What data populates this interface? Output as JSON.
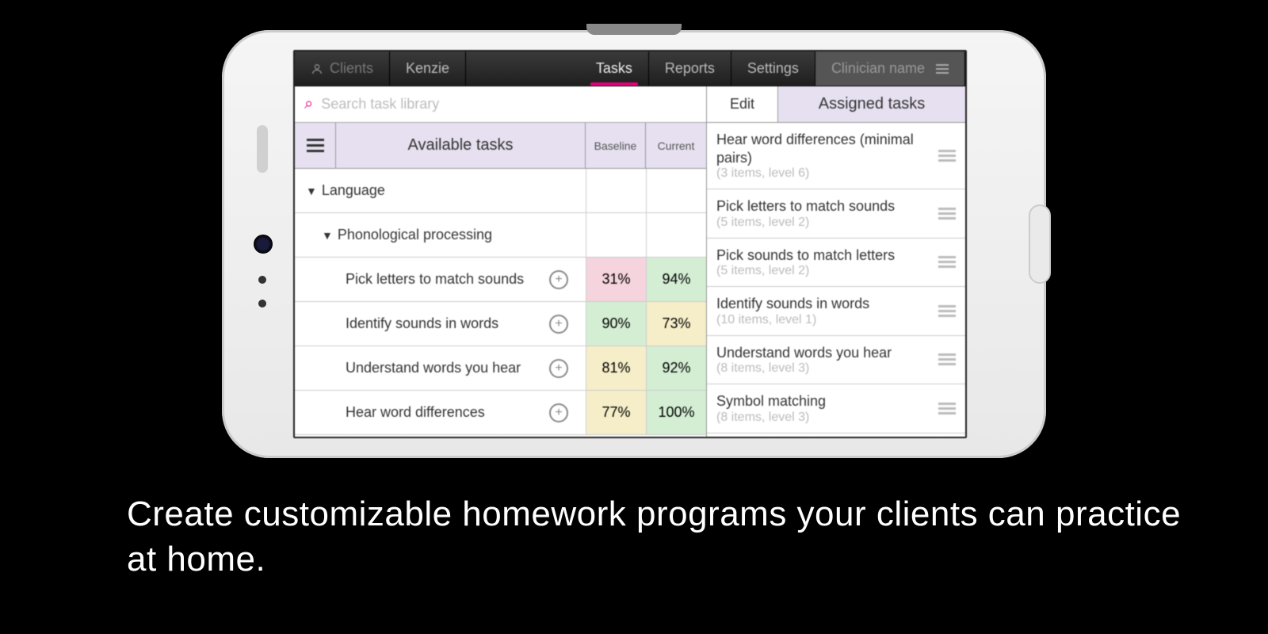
{
  "nav": {
    "clients": "Clients",
    "client_name": "Kenzie",
    "tasks": "Tasks",
    "reports": "Reports",
    "settings": "Settings",
    "clinician": "Clinician name"
  },
  "search": {
    "placeholder": "Search task library"
  },
  "left": {
    "header": {
      "available": "Available tasks",
      "baseline": "Baseline",
      "current": "Current"
    },
    "category": "Language",
    "subcategory": "Phonological processing",
    "tasks": [
      {
        "name": "Pick letters to match sounds",
        "baseline": "31%",
        "current": "94%",
        "b_cls": "bg-pink",
        "c_cls": "bg-green"
      },
      {
        "name": "Identify sounds in words",
        "baseline": "90%",
        "current": "73%",
        "b_cls": "bg-green",
        "c_cls": "bg-yellow"
      },
      {
        "name": "Understand words you hear",
        "baseline": "81%",
        "current": "92%",
        "b_cls": "bg-yellow",
        "c_cls": "bg-green"
      },
      {
        "name": "Hear word differences",
        "baseline": "77%",
        "current": "100%",
        "b_cls": "bg-yellow",
        "c_cls": "bg-green"
      }
    ]
  },
  "right": {
    "edit": "Edit",
    "assigned": "Assigned tasks",
    "items": [
      {
        "title": "Hear word differences (minimal pairs)",
        "sub": "(3 items, level 6)"
      },
      {
        "title": "Pick letters to match sounds",
        "sub": "(5 items, level 2)"
      },
      {
        "title": "Pick sounds to match letters",
        "sub": "(5 items, level 2)"
      },
      {
        "title": "Identify sounds in words",
        "sub": "(10 items, level 1)"
      },
      {
        "title": "Understand words you hear",
        "sub": "(8 items, level 3)"
      },
      {
        "title": "Symbol matching",
        "sub": "(8 items, level 3)"
      }
    ]
  },
  "caption": "Create customizable homework programs your clients can practice at home."
}
